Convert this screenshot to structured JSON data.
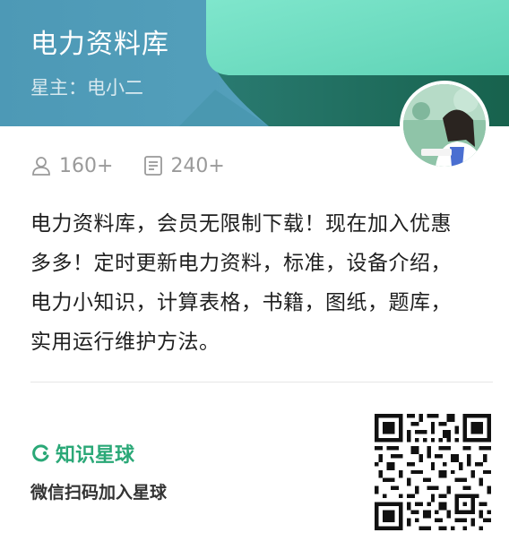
{
  "header": {
    "title": "电力资料库",
    "owner": "星主：电小二"
  },
  "stats": {
    "members": "160+",
    "posts": "240+"
  },
  "description": {
    "lines": [
      "电力资料库，会员无限制下载！现在加入优惠",
      "多多！定时更新电力资料，标准，设备介绍，",
      "电力小知识，计算表格，书籍，图纸，题库，",
      "实用运行维护方法。"
    ]
  },
  "footer": {
    "brand": "知识星球",
    "join_text": "微信扫码加入星球"
  },
  "colors": {
    "brand_green": "#2aa877",
    "header_blue": "#4f9bb7",
    "header_green": "#1c6b56",
    "highlight_mint": "#7de3c8"
  },
  "icons": {
    "members": "user-icon",
    "posts": "document-icon",
    "brand": "planet-ring-icon"
  }
}
